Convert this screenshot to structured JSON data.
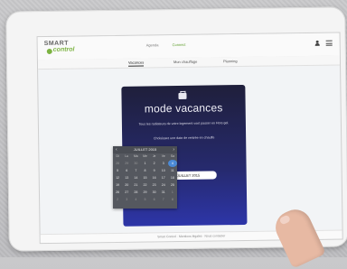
{
  "logo": {
    "line1": "SMART",
    "line2": "control"
  },
  "status": {
    "left": "Agenda",
    "right": "Connect"
  },
  "tabs": [
    "Vacances",
    "Mon chauffage",
    "Planning"
  ],
  "card": {
    "title": "mode vacances",
    "text1": "Tous les radiateurs de votre logement vont passer en Hors gel.",
    "text2": "Choisissez une date de rentrée en chauffe",
    "date_value": "Samedi 4 JUILLET 2015"
  },
  "picker": {
    "header": "JUILLET 2015",
    "weekdays": [
      "Di",
      "Lu",
      "Ma",
      "Me",
      "Je",
      "Ve",
      "Sa"
    ],
    "weeks": [
      [
        "28",
        "29",
        "30",
        "1",
        "2",
        "3",
        "4"
      ],
      [
        "5",
        "6",
        "7",
        "8",
        "9",
        "10",
        "11"
      ],
      [
        "12",
        "13",
        "14",
        "15",
        "16",
        "17",
        "18"
      ],
      [
        "19",
        "20",
        "21",
        "22",
        "23",
        "24",
        "25"
      ],
      [
        "26",
        "27",
        "28",
        "29",
        "30",
        "31",
        "1"
      ],
      [
        "2",
        "3",
        "4",
        "5",
        "6",
        "7",
        "8"
      ]
    ],
    "selected": "4"
  },
  "footer": "Smart Control · Mentions légales · Nous contacter"
}
